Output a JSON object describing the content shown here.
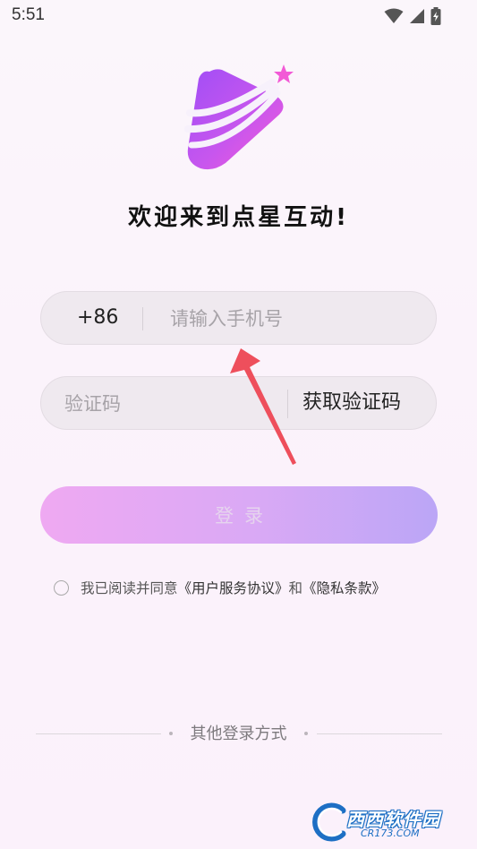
{
  "status_bar": {
    "time": "5:51",
    "icons": [
      "wifi-icon",
      "signal-icon",
      "battery-charging-icon"
    ]
  },
  "branding": {
    "welcome_text": "欢迎来到点星互动!"
  },
  "phone": {
    "country_code": "+86",
    "placeholder": "请输入手机号",
    "value": ""
  },
  "code": {
    "placeholder": "验证码",
    "value": "",
    "get_code_label": "获取验证码"
  },
  "login": {
    "label": "登录"
  },
  "agreement": {
    "checked": false,
    "prefix": "我已阅读并同意",
    "terms_link": "《用户服务协议》",
    "conjunction": "和",
    "privacy_link": "《隐私条款》"
  },
  "other_login": {
    "title": "其他登录方式"
  },
  "watermark": {
    "text": "西西软件园",
    "sub": "CR173.COM"
  },
  "colors": {
    "accent_start": "#efa9f2",
    "accent_end": "#bba6f6",
    "logo_purple": "#9c4ef6",
    "logo_pink": "#f25ad6",
    "annotation_red": "#ee4f5c"
  }
}
